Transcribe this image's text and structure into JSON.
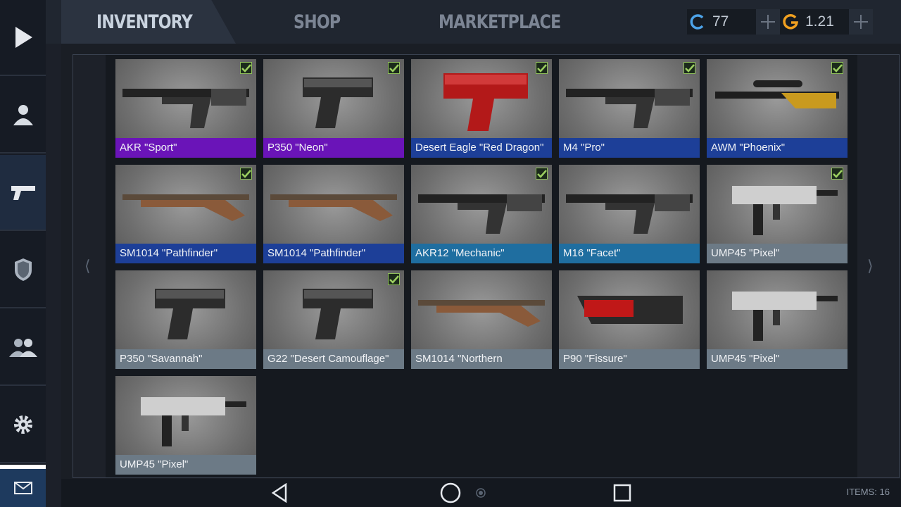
{
  "tabs": [
    {
      "label": "INVENTORY",
      "active": true
    },
    {
      "label": "SHOP",
      "active": false
    },
    {
      "label": "MARKETPLACE",
      "active": false
    }
  ],
  "currencies": [
    {
      "icon": "credit-c-icon",
      "value": "77"
    },
    {
      "icon": "gold-g-icon",
      "value": "1.21"
    }
  ],
  "sidebar": {
    "items": [
      {
        "icon": "play-icon"
      },
      {
        "icon": "profile-icon"
      },
      {
        "icon": "pistol-icon",
        "active": true
      },
      {
        "icon": "clan-emblem-icon"
      },
      {
        "icon": "friends-icon"
      },
      {
        "icon": "settings-gear-icon"
      }
    ],
    "mail_icon": "mail-icon"
  },
  "inventory": {
    "items": [
      {
        "name": "AKR \"Sport\"",
        "rarity": "purple",
        "equipped": true,
        "weapon": "rifle-ak"
      },
      {
        "name": "P350 \"Neon\"",
        "rarity": "purple",
        "equipped": true,
        "weapon": "pistol"
      },
      {
        "name": "Desert Eagle \"Red Dragon\"",
        "rarity": "navy",
        "equipped": true,
        "weapon": "deagle"
      },
      {
        "name": "M4 \"Pro\"",
        "rarity": "navy",
        "equipped": true,
        "weapon": "rifle-m4"
      },
      {
        "name": "AWM \"Phoenix\"",
        "rarity": "navy",
        "equipped": true,
        "weapon": "sniper"
      },
      {
        "name": "SM1014 \"Pathfinder\"",
        "rarity": "navy",
        "equipped": true,
        "weapon": "shotgun"
      },
      {
        "name": "SM1014 \"Pathfinder\"",
        "rarity": "navy",
        "equipped": false,
        "weapon": "shotgun"
      },
      {
        "name": "AKR12 \"Mechanic\"",
        "rarity": "blue",
        "equipped": true,
        "weapon": "rifle-akr12"
      },
      {
        "name": "M16 \"Facet\"",
        "rarity": "blue",
        "equipped": false,
        "weapon": "rifle-m16"
      },
      {
        "name": "UMP45 \"Pixel\"",
        "rarity": "grey",
        "equipped": true,
        "weapon": "smg"
      },
      {
        "name": "P350 \"Savannah\"",
        "rarity": "grey",
        "equipped": false,
        "weapon": "pistol"
      },
      {
        "name": "G22 \"Desert Camouflage\"",
        "rarity": "grey",
        "equipped": true,
        "weapon": "pistol-glock"
      },
      {
        "name": "SM1014 \"Northern",
        "rarity": "grey",
        "equipped": false,
        "weapon": "shotgun"
      },
      {
        "name": "P90 \"Fissure\"",
        "rarity": "grey",
        "equipped": false,
        "weapon": "p90"
      },
      {
        "name": "UMP45 \"Pixel\"",
        "rarity": "grey",
        "equipped": false,
        "weapon": "smg"
      },
      {
        "name": "UMP45 \"Pixel\"",
        "rarity": "grey",
        "equipped": false,
        "weapon": "smg"
      }
    ]
  },
  "footer": {
    "items_count": "ITEMS: 16"
  },
  "colors": {
    "purple": "#6a14b8",
    "navy": "#1d3f98",
    "blue": "#1f6ea0",
    "grey": "#6c7a86",
    "accent_check": "#8fbf5a"
  }
}
